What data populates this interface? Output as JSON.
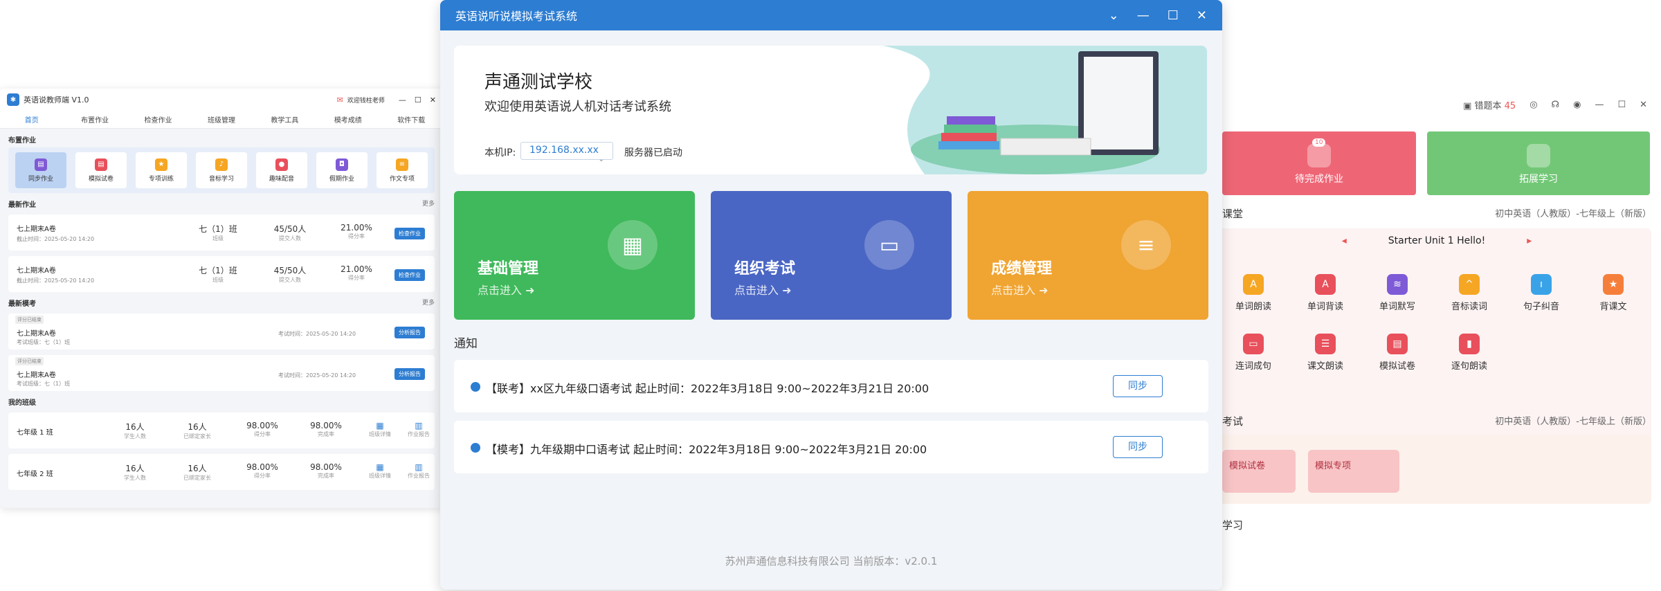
{
  "left": {
    "app_title": "英语说教师端 V1.0",
    "user": "欢迎钱柱老师",
    "nav": [
      "首页",
      "布置作业",
      "检查作业",
      "班级管理",
      "教学工具",
      "模考成绩",
      "软件下载"
    ],
    "sec_assign": "布置作业",
    "quick": [
      "同步作业",
      "模拟试卷",
      "专项训练",
      "音标学习",
      "趣味配音",
      "假期作业",
      "作文专项"
    ],
    "sec_recent": "最新作业",
    "more": "更多",
    "homework": [
      {
        "title": "七上期末A卷",
        "deadline": "截止时间：2025-05-20 14:20",
        "class": "七（1）班",
        "class_l": "班级",
        "submit": "45/50人",
        "submit_l": "提交人数",
        "score": "21.00%",
        "score_l": "得分率",
        "btn": "检查作业"
      },
      {
        "title": "七上期末A卷",
        "deadline": "截止时间：2025-05-20 14:20",
        "class": "七（1）班",
        "class_l": "班级",
        "submit": "45/50人",
        "submit_l": "提交人数",
        "score": "21.00%",
        "score_l": "得分率",
        "btn": "检查作业"
      }
    ],
    "sec_exam": "最新模考",
    "exams": [
      {
        "tag": "评分已结束",
        "title": "七上期末A卷",
        "cls": "考试班级：七（1）班",
        "time": "考试时间：2025-05-20 14:20",
        "btn": "分析报告"
      },
      {
        "tag": "评分已结束",
        "title": "七上期末A卷",
        "cls": "考试班级：七（1）班",
        "time": "考试时间：2025-05-20 14:20",
        "btn": "分析报告"
      }
    ],
    "sec_class": "我的班级",
    "classes": [
      {
        "name": "七年级 1 班",
        "students": "16人",
        "students_l": "学生人数",
        "parents": "16人",
        "parents_l": "已绑定家长",
        "score": "98.00%",
        "score_l": "得分率",
        "done": "98.00%",
        "done_l": "完成率",
        "a1": "班级详情",
        "a2": "作业报告"
      },
      {
        "name": "七年级 2 班",
        "students": "16人",
        "students_l": "学生人数",
        "parents": "16人",
        "parents_l": "已绑定家长",
        "score": "98.00%",
        "score_l": "得分率",
        "done": "98.00%",
        "done_l": "完成率",
        "a1": "班级详情",
        "a2": "作业报告"
      }
    ]
  },
  "mid": {
    "title": "英语说听说模拟考试系统",
    "school": "声通测试学校",
    "welcome": "欢迎使用英语说人机对话考试系统",
    "ip_label": "本机IP:",
    "ip_value": "192.168.xx.xx",
    "server": "服务器已启动",
    "tiles": [
      {
        "name": "基础管理",
        "enter": "点击进入"
      },
      {
        "name": "组织考试",
        "enter": "点击进入"
      },
      {
        "name": "成绩管理",
        "enter": "点击进入"
      }
    ],
    "notice_title": "通知",
    "notices": [
      {
        "text": "【联考】xx区九年级口语考试  起止时间：2022年3月18日 9:00~2022年3月21日 20:00",
        "btn": "同步"
      },
      {
        "text": "【模考】九年级期中口语考试  起止时间：2022年3月18日 9:00~2022年3月21日 20:00",
        "btn": "同步"
      }
    ],
    "footer": "苏州声通信息科技有限公司  当前版本：v2.0.1"
  },
  "right": {
    "wrongbook": "错题本",
    "wrong_count": "45",
    "badge": "10",
    "tile1": "待完成作业",
    "tile2": "拓展学习",
    "sec1": "课堂",
    "sec1_r": "初中英语（人教版）-七年级上（新版）",
    "unit": "Starter Unit 1 Hello!",
    "items": [
      "单词朗读",
      "单词背读",
      "单词默写",
      "音标读词",
      "句子纠音",
      "背课文",
      "连词成句",
      "课文朗读",
      "模拟试卷",
      "逐句朗读"
    ],
    "sec2": "考试",
    "sec2_r": "初中英语（人教版）-七年级上（新版）",
    "m1": "模拟试卷",
    "m2": "模拟专项",
    "sec3": "学习"
  }
}
